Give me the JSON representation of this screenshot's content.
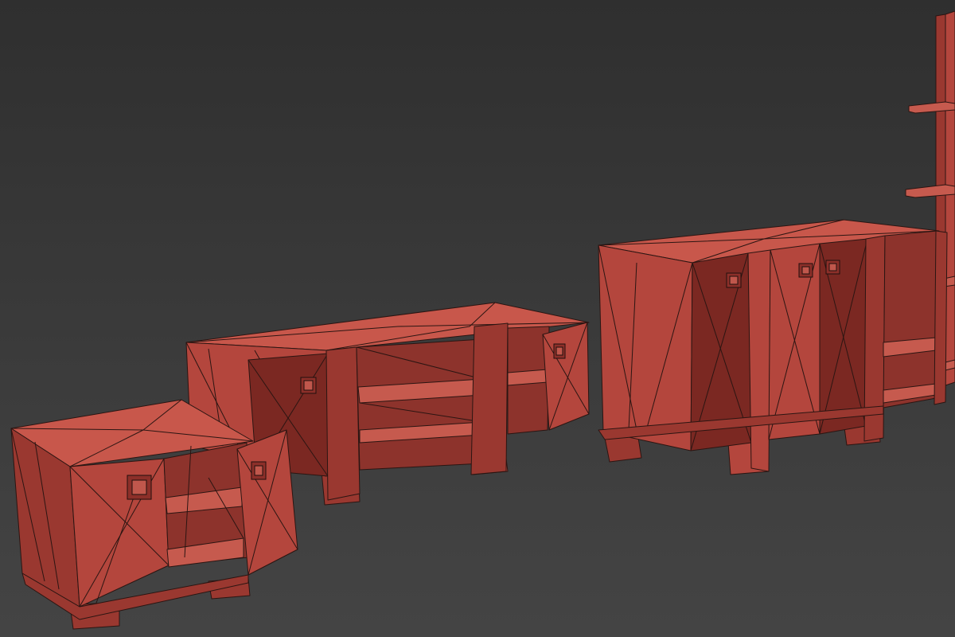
{
  "scene": {
    "background": {
      "top": "#2f2f2f",
      "mid": "#3b3b3b",
      "bottom": "#444444"
    },
    "material_color": "#b4463d",
    "wire_color": "#2b1512",
    "objects": [
      {
        "name": "nightstand",
        "kind": "cabinet",
        "doors": 2,
        "door_state": "one-open"
      },
      {
        "name": "tv-stand",
        "kind": "low-cabinet",
        "doors": 2,
        "shelves": 2
      },
      {
        "name": "sideboard",
        "kind": "cabinet",
        "doors": 4
      },
      {
        "name": "shelving-unit",
        "kind": "tall-shelf",
        "visible": "partial"
      }
    ]
  }
}
